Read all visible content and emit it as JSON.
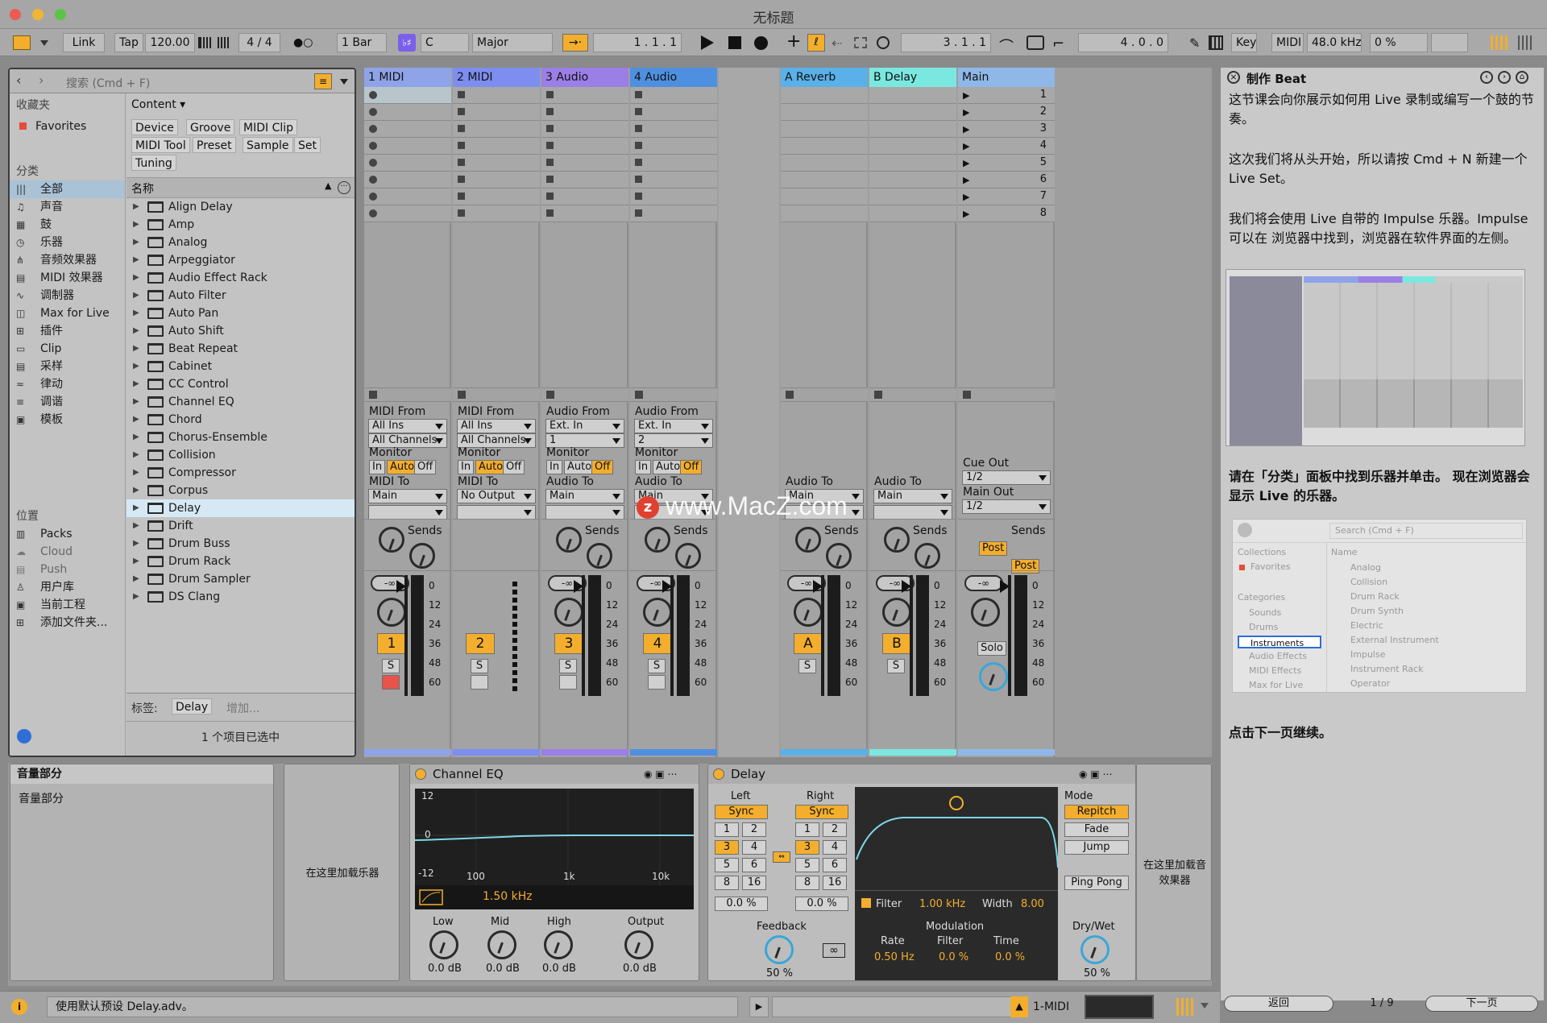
{
  "app": {
    "title": "无标题"
  },
  "control": {
    "link": "Link",
    "tap": "Tap",
    "tempo": "120.00",
    "sig": "4 / 4",
    "quant": "1 Bar",
    "key": "C",
    "scale": "Major",
    "pos": "1 .   1 .   1",
    "loop_start": "3 .   1 .   1",
    "loop_len": "4 .   0 .   0",
    "key_btn": "Key",
    "midi_btn": "MIDI",
    "rate": "48.0 kHz",
    "cpu": "0 %"
  },
  "browser": {
    "search_placeholder": "搜索 (Cmd + F)",
    "collections_label": "收藏夹",
    "favorites": "Favorites",
    "categories_label": "分类",
    "categories": [
      "全部",
      "声音",
      "鼓",
      "乐器",
      "音频效果器",
      "MIDI 效果器",
      "调制器",
      "Max for Live",
      "插件",
      "Clip",
      "采样",
      "律动",
      "调谐",
      "模板"
    ],
    "places_label": "位置",
    "places": [
      "Packs",
      "Cloud",
      "Push",
      "用户库",
      "当前工程",
      "添加文件夹..."
    ],
    "content_label": "Content ▾",
    "chips": [
      "Device",
      "Groove",
      "MIDI Clip",
      "MIDI Tool",
      "Preset",
      "Sample",
      "Set",
      "Tuning"
    ],
    "name_header": "名称",
    "items": [
      "Align Delay",
      "Amp",
      "Analog",
      "Arpeggiator",
      "Audio Effect Rack",
      "Auto Filter",
      "Auto Pan",
      "Auto Shift",
      "Beat Repeat",
      "Cabinet",
      "CC Control",
      "Channel EQ",
      "Chord",
      "Chorus-Ensemble",
      "Collision",
      "Compressor",
      "Corpus",
      "Delay",
      "Drift",
      "Drum Buss",
      "Drum Rack",
      "Drum Sampler",
      "DS Clang"
    ],
    "tag_label": "标签:",
    "tag_value": "Delay",
    "tag_add": "增加...",
    "selected_status": "1 个项目已选中"
  },
  "tracks": [
    {
      "name": "1 MIDI",
      "color": "#8fa3e8",
      "from_label": "MIDI From",
      "from": "All Ins",
      "ch": "All Channels",
      "to_label": "MIDI To",
      "to": "Main",
      "num": "1",
      "mon_on": "Auto"
    },
    {
      "name": "2 MIDI",
      "color": "#7d8ef0",
      "from_label": "MIDI From",
      "from": "All Ins",
      "ch": "All Channels",
      "to_label": "MIDI To",
      "to": "No Output",
      "num": "2",
      "mon_on": "Auto"
    },
    {
      "name": "3 Audio",
      "color": "#9b7fe6",
      "from_label": "Audio From",
      "from": "Ext. In",
      "ch": "1",
      "to_label": "Audio To",
      "to": "Main",
      "num": "3",
      "mon_on": "Off"
    },
    {
      "name": "4 Audio",
      "color": "#4f8fe0",
      "from_label": "Audio From",
      "from": "Ext. In",
      "ch": "2",
      "to_label": "Audio To",
      "to": "Main",
      "num": "4",
      "mon_on": "Off"
    },
    {
      "name": "A Reverb",
      "color": "#5ab0e8",
      "to_label": "Audio To",
      "to": "Main",
      "num": "A"
    },
    {
      "name": "B Delay",
      "color": "#7be8e0",
      "to_label": "Audio To",
      "to": "Main",
      "num": "B"
    },
    {
      "name": "Main",
      "color": "#8fb8e8",
      "cue_label": "Cue Out",
      "cue": "1/2",
      "main_label": "Main Out",
      "main": "1/2",
      "solo": "Solo"
    }
  ],
  "mixer": {
    "monitor": "Monitor",
    "in": "In",
    "auto": "Auto",
    "off": "Off",
    "sends": "Sends",
    "vol": "-∞",
    "s": "S",
    "post": "Post",
    "ticks": [
      "0",
      "12",
      "24",
      "36",
      "48",
      "60"
    ],
    "scenes": [
      "1",
      "2",
      "3",
      "4",
      "5",
      "6",
      "7",
      "8"
    ]
  },
  "help": {
    "title": "制作 Beat",
    "p1": "这节课会向你展示如何用 Live 录制或编写一个鼓的节奏。",
    "p2": "这次我们将从头开始，所以请按 Cmd + N 新建一个 Live Set。",
    "p3": "我们将会使用 Live 自带的 Impulse 乐器。Impulse 可以在 浏览器中找到，浏览器在软件界面的左侧。",
    "p4": "请在「分类」面板中找到乐器并单击。 现在浏览器会显示 Live 的乐器。",
    "p5": "点击下一页继续。",
    "mini_search": "Search (Cmd + F)",
    "mini_collections": "Collections",
    "mini_fav": "Favorites",
    "mini_categories": "Categories",
    "mini_name": "Name",
    "mini_cats": [
      "Sounds",
      "Drums",
      "Instruments",
      "Audio Effects",
      "MIDI Effects",
      "Max for Live"
    ],
    "mini_items": [
      "Analog",
      "Collision",
      "Drum Rack",
      "Drum Synth",
      "Electric",
      "External Instrument",
      "Impulse",
      "Instrument Rack",
      "Operator"
    ],
    "back": "返回",
    "page": "1 / 9",
    "next": "下一页"
  },
  "detail": {
    "vol_title": "音量部分",
    "vol_sub": "音量部分",
    "drop_inst": "在这里加载乐器",
    "drop_fx": "在这里加载音效果器",
    "eq_title": "Channel EQ",
    "eq_y_top": "12",
    "eq_y_mid": "0",
    "eq_y_bot": "-12",
    "eq_x": [
      "100",
      "1k",
      "10k"
    ],
    "eq_freq": "1.50 kHz",
    "eq_knobs": [
      {
        "label": "Low",
        "val": "0.0 dB"
      },
      {
        "label": "Mid",
        "val": "0.0 dB"
      },
      {
        "label": "High",
        "val": "0.0 dB"
      },
      {
        "label": "Output",
        "val": "0.0 dB"
      }
    ],
    "delay_title": "Delay",
    "left": "Left",
    "right": "Right",
    "sync": "Sync",
    "grid": [
      "1",
      "2",
      "3",
      "4",
      "5",
      "6",
      "8",
      "16"
    ],
    "pct": "0.0 %",
    "feedback": "Feedback",
    "fb_val": "50 %",
    "filter": "Filter",
    "filter_val": "1.00 kHz",
    "width": "Width",
    "width_val": "8.00",
    "modulation": "Modulation",
    "rate": "Rate",
    "rate_val": "0.50 Hz",
    "mfilter": "Filter",
    "mfilter_val": "0.0 %",
    "time": "Time",
    "time_val": "0.0 %",
    "mode": "Mode",
    "repitch": "Repitch",
    "fade": "Fade",
    "jump": "Jump",
    "pingpong": "Ping Pong",
    "drywet": "Dry/Wet",
    "dw_val": "50 %"
  },
  "status": {
    "text": "使用默认预设 Delay.adv。",
    "track": "1-MIDI"
  },
  "watermark": "www.MacZ.com"
}
